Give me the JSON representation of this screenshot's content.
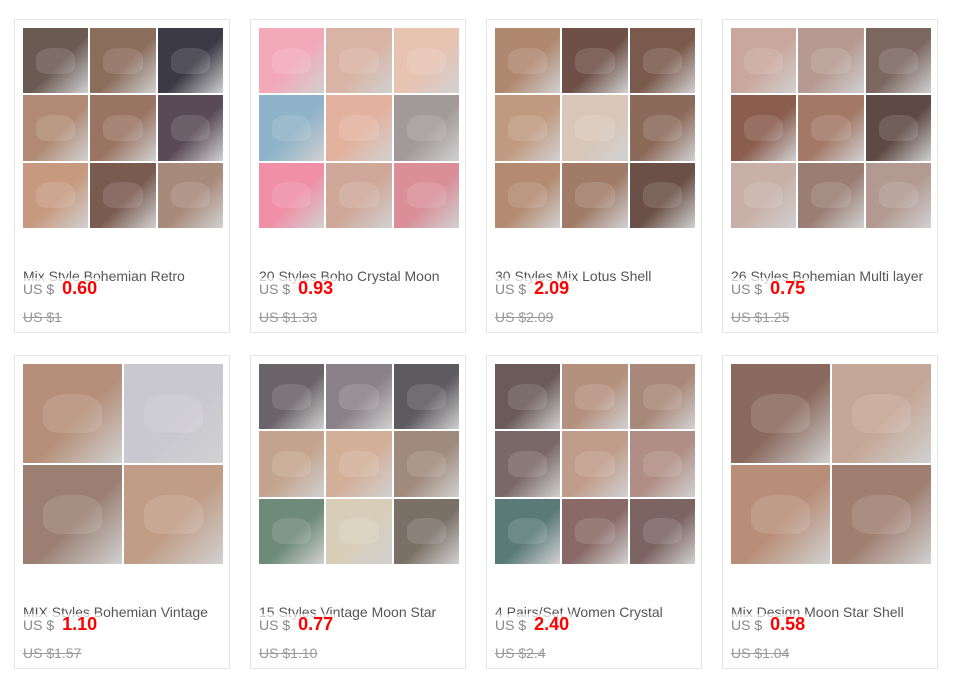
{
  "products": [
    {
      "title": "Mix Style Bohemian Retro",
      "currency": "US $",
      "price": "0.60",
      "original_price": "US $1",
      "colors": [
        "#6b5a52",
        "#8b6d5c",
        "#3b3a46",
        "#b08a74",
        "#9a7463",
        "#5a4a55",
        "#c79a80",
        "#7a5b50",
        "#a88a7a"
      ]
    },
    {
      "title": "20 Styles Boho Crystal Moon",
      "currency": "US $",
      "price": "0.93",
      "original_price": "US $1.33",
      "colors": [
        "#f2a9b8",
        "#d9b3a3",
        "#e7c3b2",
        "#8fb3c8",
        "#e3b29f",
        "#a19a98",
        "#f08fa5",
        "#cfa89a",
        "#d98e98"
      ]
    },
    {
      "title": "30 Styles Mix Lotus Shell",
      "currency": "US $",
      "price": "2.09",
      "original_price": "US $2.09",
      "colors": [
        "#b08870",
        "#6e5048",
        "#7a5a4c",
        "#c09a80",
        "#d8c6b8",
        "#8c6a5a",
        "#b48a70",
        "#a07c68",
        "#6a5046"
      ]
    },
    {
      "title": "26 Styles Bohemian Multi layer",
      "currency": "US $",
      "price": "0.75",
      "original_price": "US $1.25",
      "colors": [
        "#caa79c",
        "#b69a92",
        "#7c6760",
        "#8a5d4e",
        "#a37866",
        "#5e4a44",
        "#c8b0a8",
        "#9a7e74",
        "#b29a92"
      ]
    },
    {
      "title": "MIX Styles Bohemian Vintage",
      "currency": "US $",
      "price": "1.10",
      "original_price": "US $1.57",
      "colors": [
        "#b58f79",
        "#c9c7cf",
        "#9a7f72",
        "#c19c86"
      ]
    },
    {
      "title": "15 Styles Vintage Moon Star",
      "currency": "US $",
      "price": "0.77",
      "original_price": "US $1.10",
      "colors": [
        "#6a6468",
        "#8a8288",
        "#5d5a60",
        "#c4a48e",
        "#d2b09a",
        "#a08a7c",
        "#6e8a78",
        "#d8cdb8",
        "#7a7066"
      ]
    },
    {
      "title": "4 Pairs/Set Women Crystal",
      "currency": "US $",
      "price": "2.40",
      "original_price": "US $2.4",
      "colors": [
        "#6a5a58",
        "#b4907e",
        "#a88878",
        "#7a6868",
        "#c09c8a",
        "#b08e86",
        "#5a7a78",
        "#8a6a66",
        "#7c6462"
      ]
    },
    {
      "title": "Mix Design Moon Star Shell",
      "currency": "US $",
      "price": "0.58",
      "original_price": "US $1.04",
      "colors": [
        "#8a6a5e",
        "#c4a696",
        "#b88e78",
        "#a07e70"
      ]
    }
  ]
}
